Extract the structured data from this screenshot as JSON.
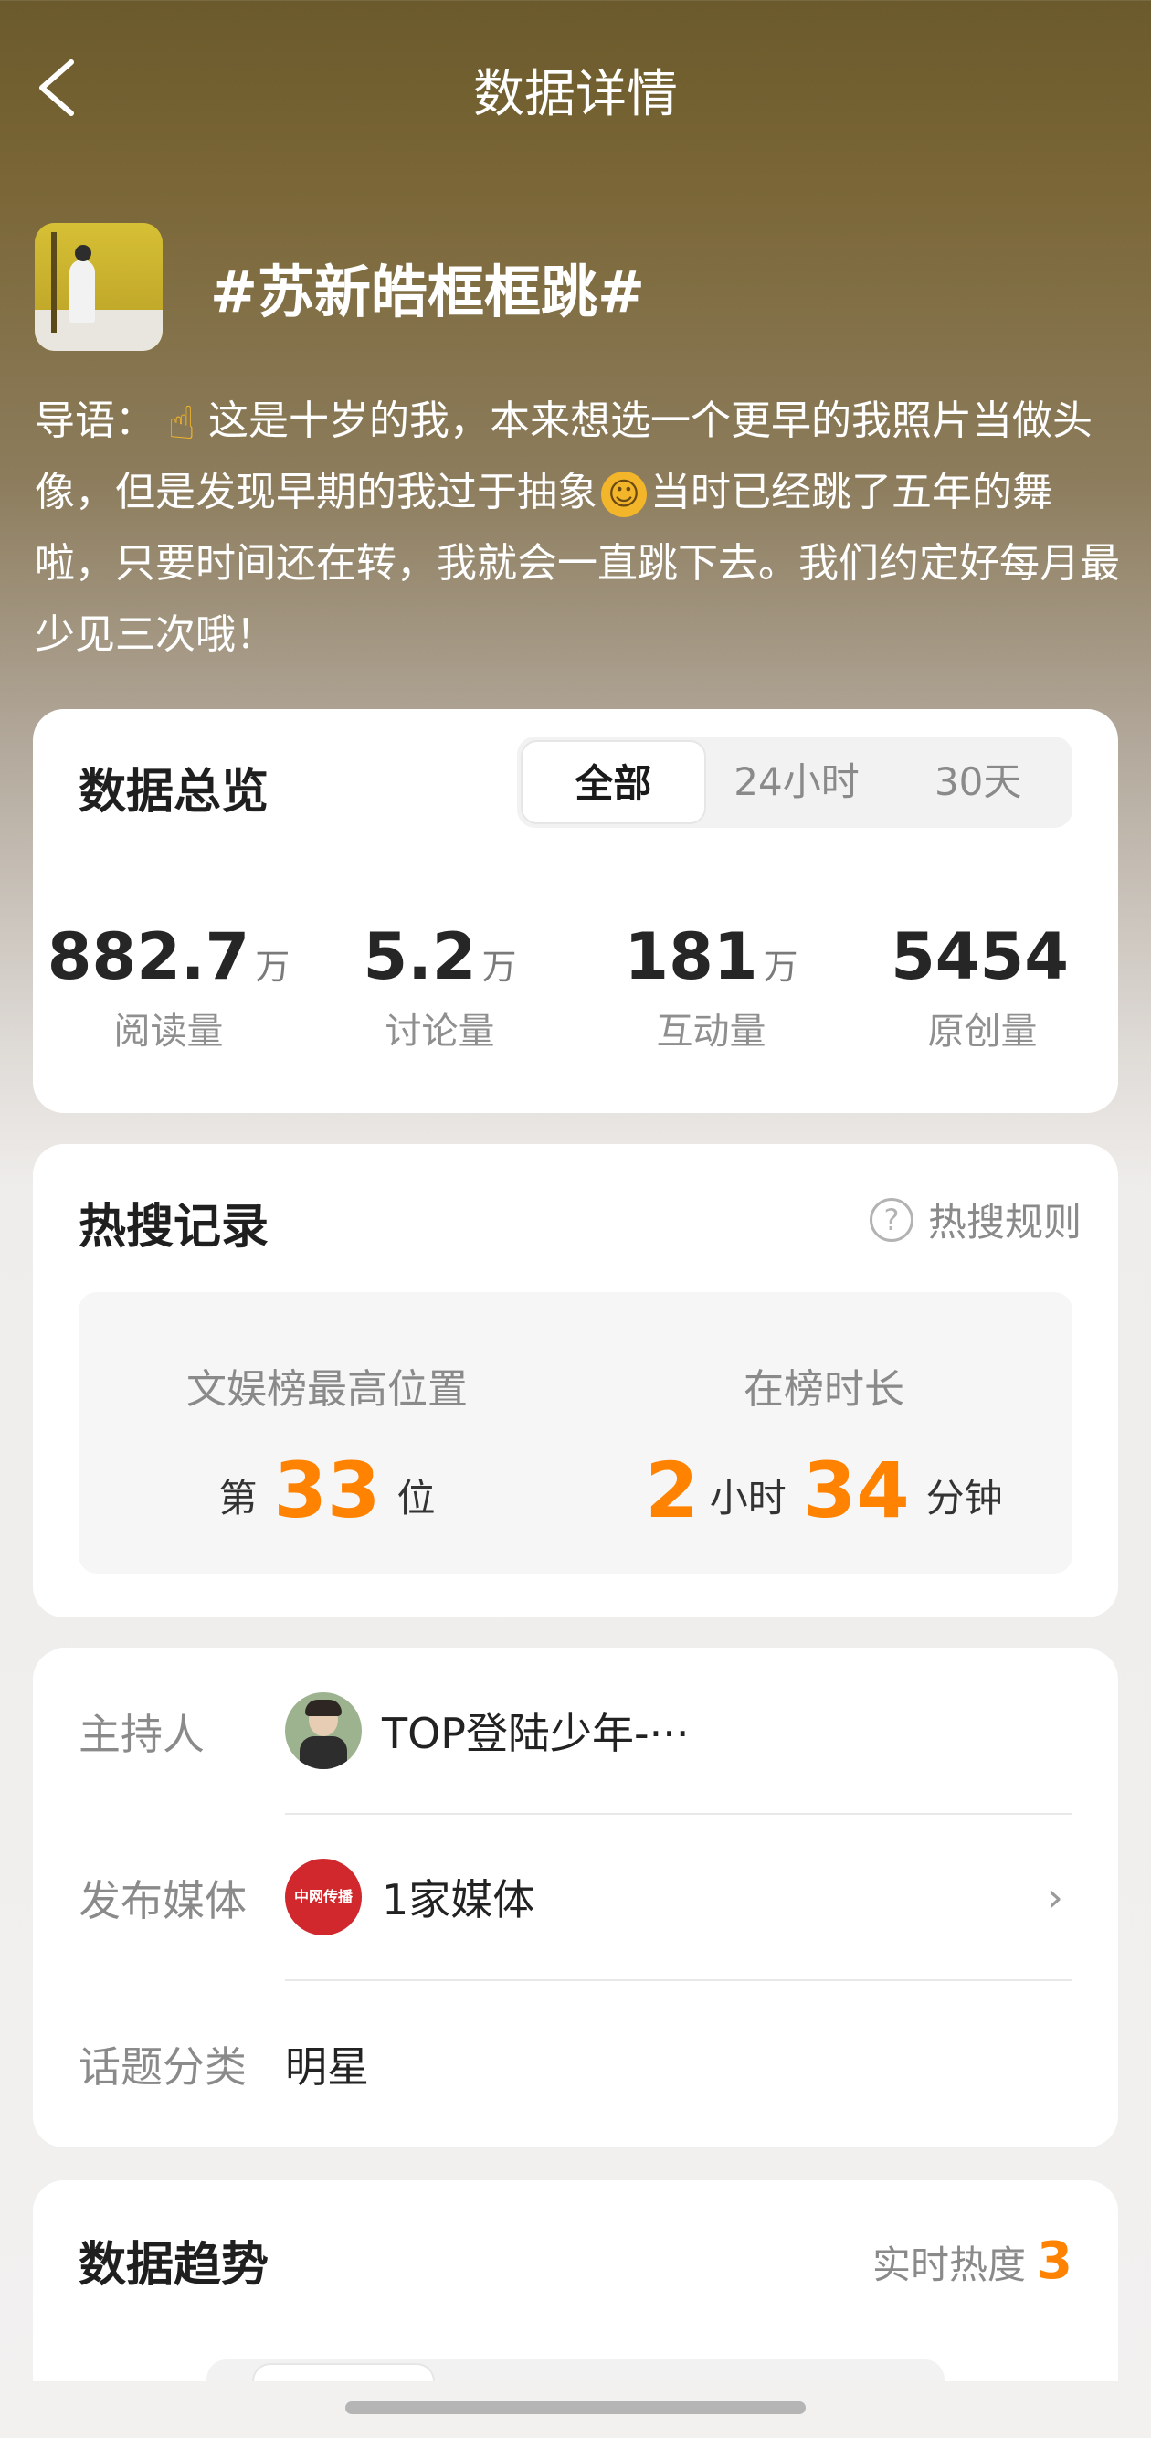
{
  "nav": {
    "title": "数据详情",
    "back_icon": "chevron-left-icon"
  },
  "topic": {
    "title": "#苏新皓框框跳#",
    "intro_parts": [
      "导语：",
      "这是十岁的我，本来想选一个更早的我照片当做头像，但是发现早期的我过于抽象",
      "当时已经跳了五年的舞啦，只要时间还在转，我就会一直跳下去。我们约定好每月最少见三次哦！"
    ]
  },
  "overview": {
    "title": "数据总览",
    "tabs": [
      "全部",
      "24小时",
      "30天"
    ],
    "active_tab": "全部",
    "stats": [
      {
        "value": "882.7",
        "unit": "万",
        "label": "阅读量"
      },
      {
        "value": "5.2",
        "unit": "万",
        "label": "讨论量"
      },
      {
        "value": "181",
        "unit": "万",
        "label": "互动量"
      },
      {
        "value": "5454",
        "unit": "",
        "label": "原创量"
      }
    ]
  },
  "hot_search": {
    "title": "热搜记录",
    "rules_label": "热搜规则",
    "best_position_label": "文娱榜最高位置",
    "best_position_prefix": "第",
    "best_position": "33",
    "best_position_suffix": "位",
    "duration_label": "在榜时长",
    "duration_hours": "2",
    "hours_unit": "小时",
    "duration_minutes": "34",
    "minutes_unit": "分钟",
    "accent_color": "#ff8200"
  },
  "info": {
    "host_label": "主持人",
    "host_name": "TOP登陆少年-···",
    "media_label": "发布媒体",
    "media_logo_text": "中网传播",
    "media_value": "1家媒体",
    "category_label": "话题分类",
    "category_value": "明星"
  },
  "trend": {
    "title": "数据趋势",
    "heat_label": "实时热度",
    "heat_value": "3"
  }
}
